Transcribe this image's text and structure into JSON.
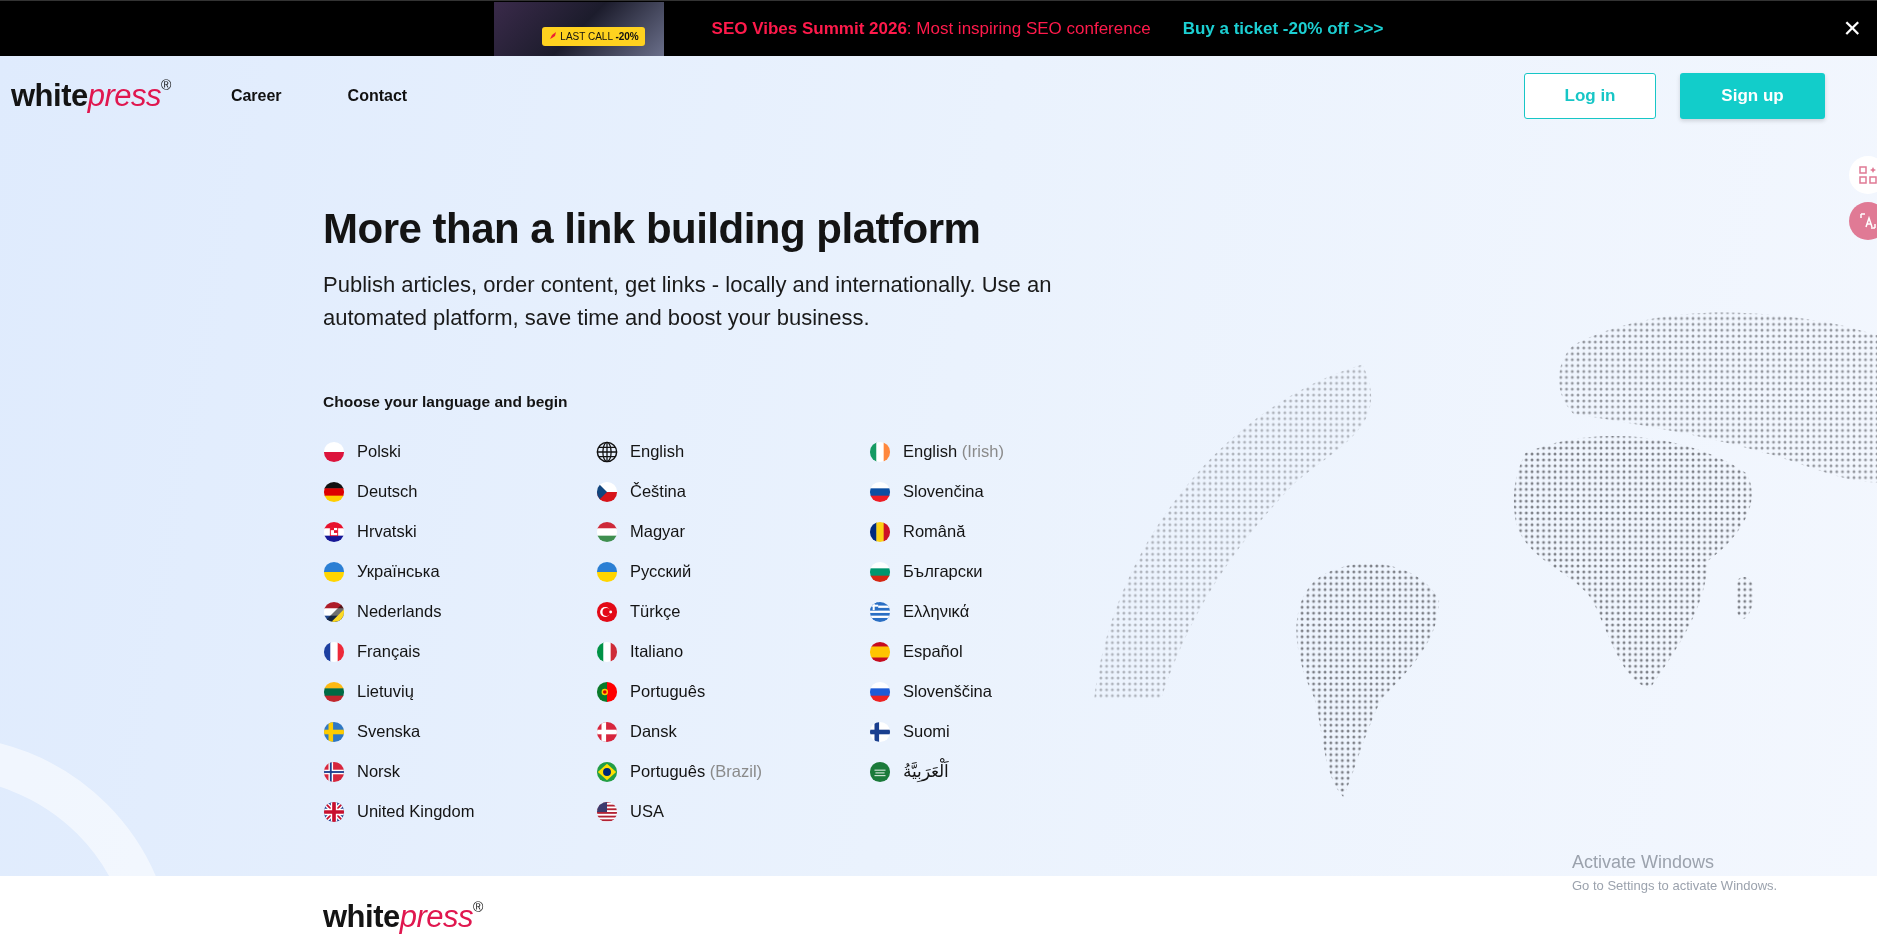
{
  "promo_banner": {
    "badge_label": "LAST CALL",
    "badge_discount": "-20%",
    "headline": "**SEO Vibes Summit 2026**: Most inspiring SEO conference",
    "link": "Buy a ticket -20% off >>>",
    "close": "×"
  },
  "header": {
    "logo": {
      "part_1": "white",
      "part_2": "press",
      "mark": "®"
    },
    "nav": [
      "Career",
      "Contact"
    ],
    "buttons": [
      {
        "label": "Log in",
        "kind": "outline"
      },
      {
        "label": "Sign up",
        "kind": "filled"
      }
    ]
  },
  "hero": {
    "title": "More than a link building platform",
    "subtitle": "Publish articles, order content, get links - locally and internationally. Use an automated platform, save time and boost your business.",
    "language_heading": "Choose your language and begin",
    "language_columns": [
      [
        {
          "label": "Polski"
        },
        {
          "label": "Deutsch"
        },
        {
          "label": "Hrvatski"
        },
        {
          "label": "Українська"
        },
        {
          "label": "Nederlands"
        },
        {
          "label": "Français"
        },
        {
          "label": "Lietuvių"
        },
        {
          "label": "Svenska"
        },
        {
          "label": "Norsk"
        },
        {
          "label": "United Kingdom"
        }
      ],
      [
        {
          "label": "English"
        },
        {
          "label": "Čeština"
        },
        {
          "label": "Magyar"
        },
        {
          "label": "Русский"
        },
        {
          "label": "Türkçe"
        },
        {
          "label": "Italiano"
        },
        {
          "label": "Português"
        },
        {
          "label": "Dansk"
        },
        {
          "label": "Português",
          "note": "(Brazil)"
        },
        {
          "label": "USA"
        }
      ],
      [
        {
          "label": "English",
          "note": "(Irish)"
        },
        {
          "label": "Slovenčina"
        },
        {
          "label": "Română"
        },
        {
          "label": "Български"
        },
        {
          "label": "Ελληνικά"
        },
        {
          "label": "Español"
        },
        {
          "label": "Slovenščina"
        },
        {
          "label": "Suomi"
        },
        {
          "label": "اَلْعَرَبِيَّةُ"
        }
      ]
    ]
  },
  "os_overlay": {
    "title": "Activate Windows",
    "subtitle": "Go to Settings to activate Windows."
  },
  "footer": {
    "logo": {
      "part_1": "white",
      "part_2": "press",
      "mark": "®"
    }
  }
}
